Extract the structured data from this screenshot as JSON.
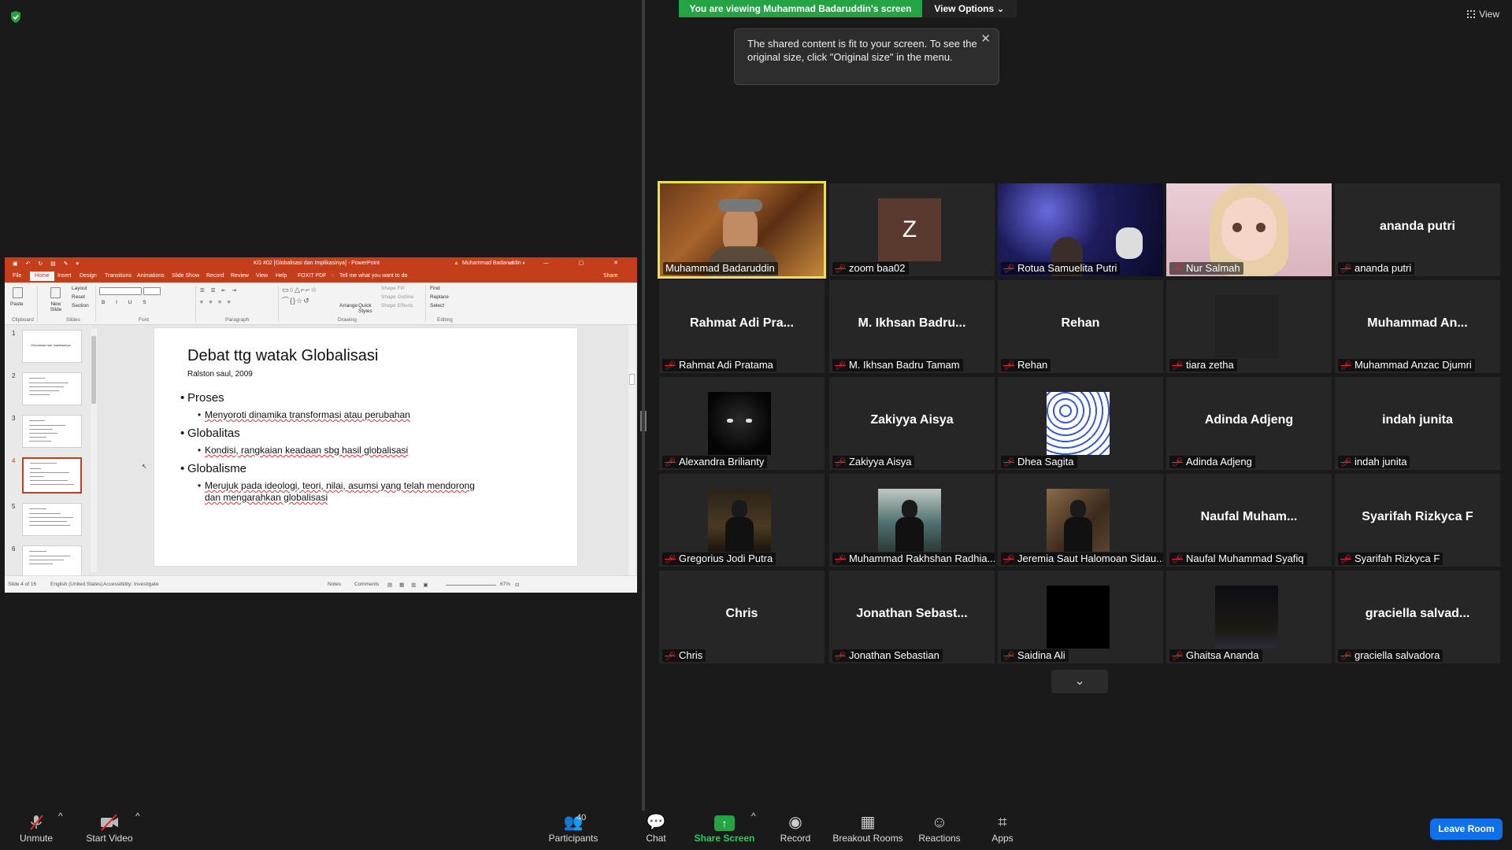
{
  "screen_share": {
    "banner": "You are viewing Muhammad Badaruddin's screen",
    "view_options": "View Options",
    "tooltip": "The shared content is fit to your screen. To see the original size, click \"Original size\" in the menu.",
    "view_button": "View"
  },
  "ppt": {
    "title": "KG #02 [Globalisasi dan Implikasinya] - PowerPoint",
    "user": "Muhammad Badaruddin",
    "tabs": [
      "File",
      "Home",
      "Insert",
      "Design",
      "Transitions",
      "Animations",
      "Slide Show",
      "Record",
      "Review",
      "View",
      "Help",
      "FOXIT PDF",
      "Tell me what you want to do"
    ],
    "share": "Share",
    "ribbon": {
      "paste": "Paste",
      "new_slide": "New Slide",
      "layout": "Layout",
      "reset": "Reset",
      "section": "Section",
      "arrange": "Arrange",
      "quick_styles": "Quick Styles",
      "shape_fill": "Shape Fill",
      "shape_outline": "Shape Outline",
      "shape_effects": "Shape Effects",
      "find": "Find",
      "replace": "Replace",
      "select": "Select",
      "groups": [
        "Clipboard",
        "Slides",
        "Font",
        "Paragraph",
        "Drawing",
        "Editing"
      ]
    },
    "thumb_numbers": [
      "1",
      "2",
      "3",
      "4",
      "5",
      "6"
    ],
    "thumb1_title": "Globalisasi dan Implikasinya",
    "slide": {
      "title": "Debat ttg watak Globalisasi",
      "subtitle": "Ralston saul, 2009",
      "b1": "Proses",
      "b1a": "Menyoroti dinamika transformasi atau perubahan",
      "b2": "Globalitas",
      "b2a": "Kondisi, rangkaian keadaan sbg hasil globalisasi",
      "b3": "Globalisme",
      "b3a": "Merujuk pada ideologi, teori, nilai, asumsi yang telah mendorong",
      "b3b": "dan mengarahkan globalisasi"
    },
    "status": {
      "slide": "Slide 4 of 16",
      "language": "English (United States)",
      "accessibility": "Accessibility: Investigate",
      "notes": "Notes",
      "comments": "Comments",
      "zoom": "67%"
    }
  },
  "participants": [
    {
      "big": "",
      "name": "Muhammad Badaruddin",
      "muted": false,
      "video": "speaker"
    },
    {
      "big": "Z",
      "name": "zoom baa02",
      "muted": true,
      "video": "avatar"
    },
    {
      "big": "",
      "name": "Rotua Samuelita Putri",
      "muted": true,
      "video": "space"
    },
    {
      "big": "",
      "name": "Nur Salmah",
      "muted": true,
      "video": "doll"
    },
    {
      "big": "ananda putri",
      "name": "ananda putri",
      "muted": true,
      "video": "none"
    },
    {
      "big": "Rahmat Adi Pra...",
      "name": "Rahmat Adi Pratama",
      "muted": true,
      "video": "none"
    },
    {
      "big": "M. Ikhsan Badru...",
      "name": "M. Ikhsan Badru Tamam",
      "muted": true,
      "video": "none"
    },
    {
      "big": "Rehan",
      "name": "Rehan",
      "muted": true,
      "video": "none"
    },
    {
      "big": "",
      "name": "tiara zetha",
      "muted": true,
      "video": "blank"
    },
    {
      "big": "Muhammad An...",
      "name": "Muhammad Anzac Djumri",
      "muted": true,
      "video": "none"
    },
    {
      "big": "",
      "name": "Alexandra Brilianty",
      "muted": true,
      "video": "cat"
    },
    {
      "big": "Zakiyya Aisya",
      "name": "Zakiyya Aisya",
      "muted": true,
      "video": "none"
    },
    {
      "big": "",
      "name": "Dhea Sagita",
      "muted": true,
      "video": "pattern"
    },
    {
      "big": "Adinda Adjeng",
      "name": "Adinda Adjeng",
      "muted": true,
      "video": "none"
    },
    {
      "big": "indah junita",
      "name": "indah junita",
      "muted": true,
      "video": "none"
    },
    {
      "big": "",
      "name": "Gregorius Jodi Putra",
      "muted": true,
      "video": "dark-person"
    },
    {
      "big": "",
      "name": "Muhammad Rakhshan Radhia...",
      "muted": true,
      "video": "moto"
    },
    {
      "big": "",
      "name": "Jeremia Saut Halomoan Sidau...",
      "muted": true,
      "video": "guitar"
    },
    {
      "big": "Naufal Muham...",
      "name": "Naufal Muhammad Syafiq",
      "muted": true,
      "video": "none"
    },
    {
      "big": "Syarifah Rizkyca F",
      "name": "Syarifah Rizkyca F",
      "muted": true,
      "video": "none"
    },
    {
      "big": "Chris",
      "name": "Chris",
      "muted": true,
      "video": "none"
    },
    {
      "big": "Jonathan Sebast...",
      "name": "Jonathan Sebastian",
      "muted": true,
      "video": "none"
    },
    {
      "big": "",
      "name": "Saidina Ali",
      "muted": true,
      "video": "black"
    },
    {
      "big": "",
      "name": "Ghaitsa Ananda",
      "muted": true,
      "video": "night"
    },
    {
      "big": "graciella salvad...",
      "name": "graciella salvadora",
      "muted": true,
      "video": "none"
    }
  ],
  "toolbar": {
    "unmute": "Unmute",
    "start_video": "Start Video",
    "participants": "Participants",
    "participants_count": "40",
    "chat": "Chat",
    "share_screen": "Share Screen",
    "record": "Record",
    "breakout_rooms": "Breakout Rooms",
    "reactions": "Reactions",
    "apps": "Apps",
    "leave": "Leave Room"
  },
  "colors": {
    "share_green": "#23a343",
    "leave_blue": "#0e71eb",
    "speaker_border": "#e8e352",
    "ppt_red": "#c43e1c"
  }
}
